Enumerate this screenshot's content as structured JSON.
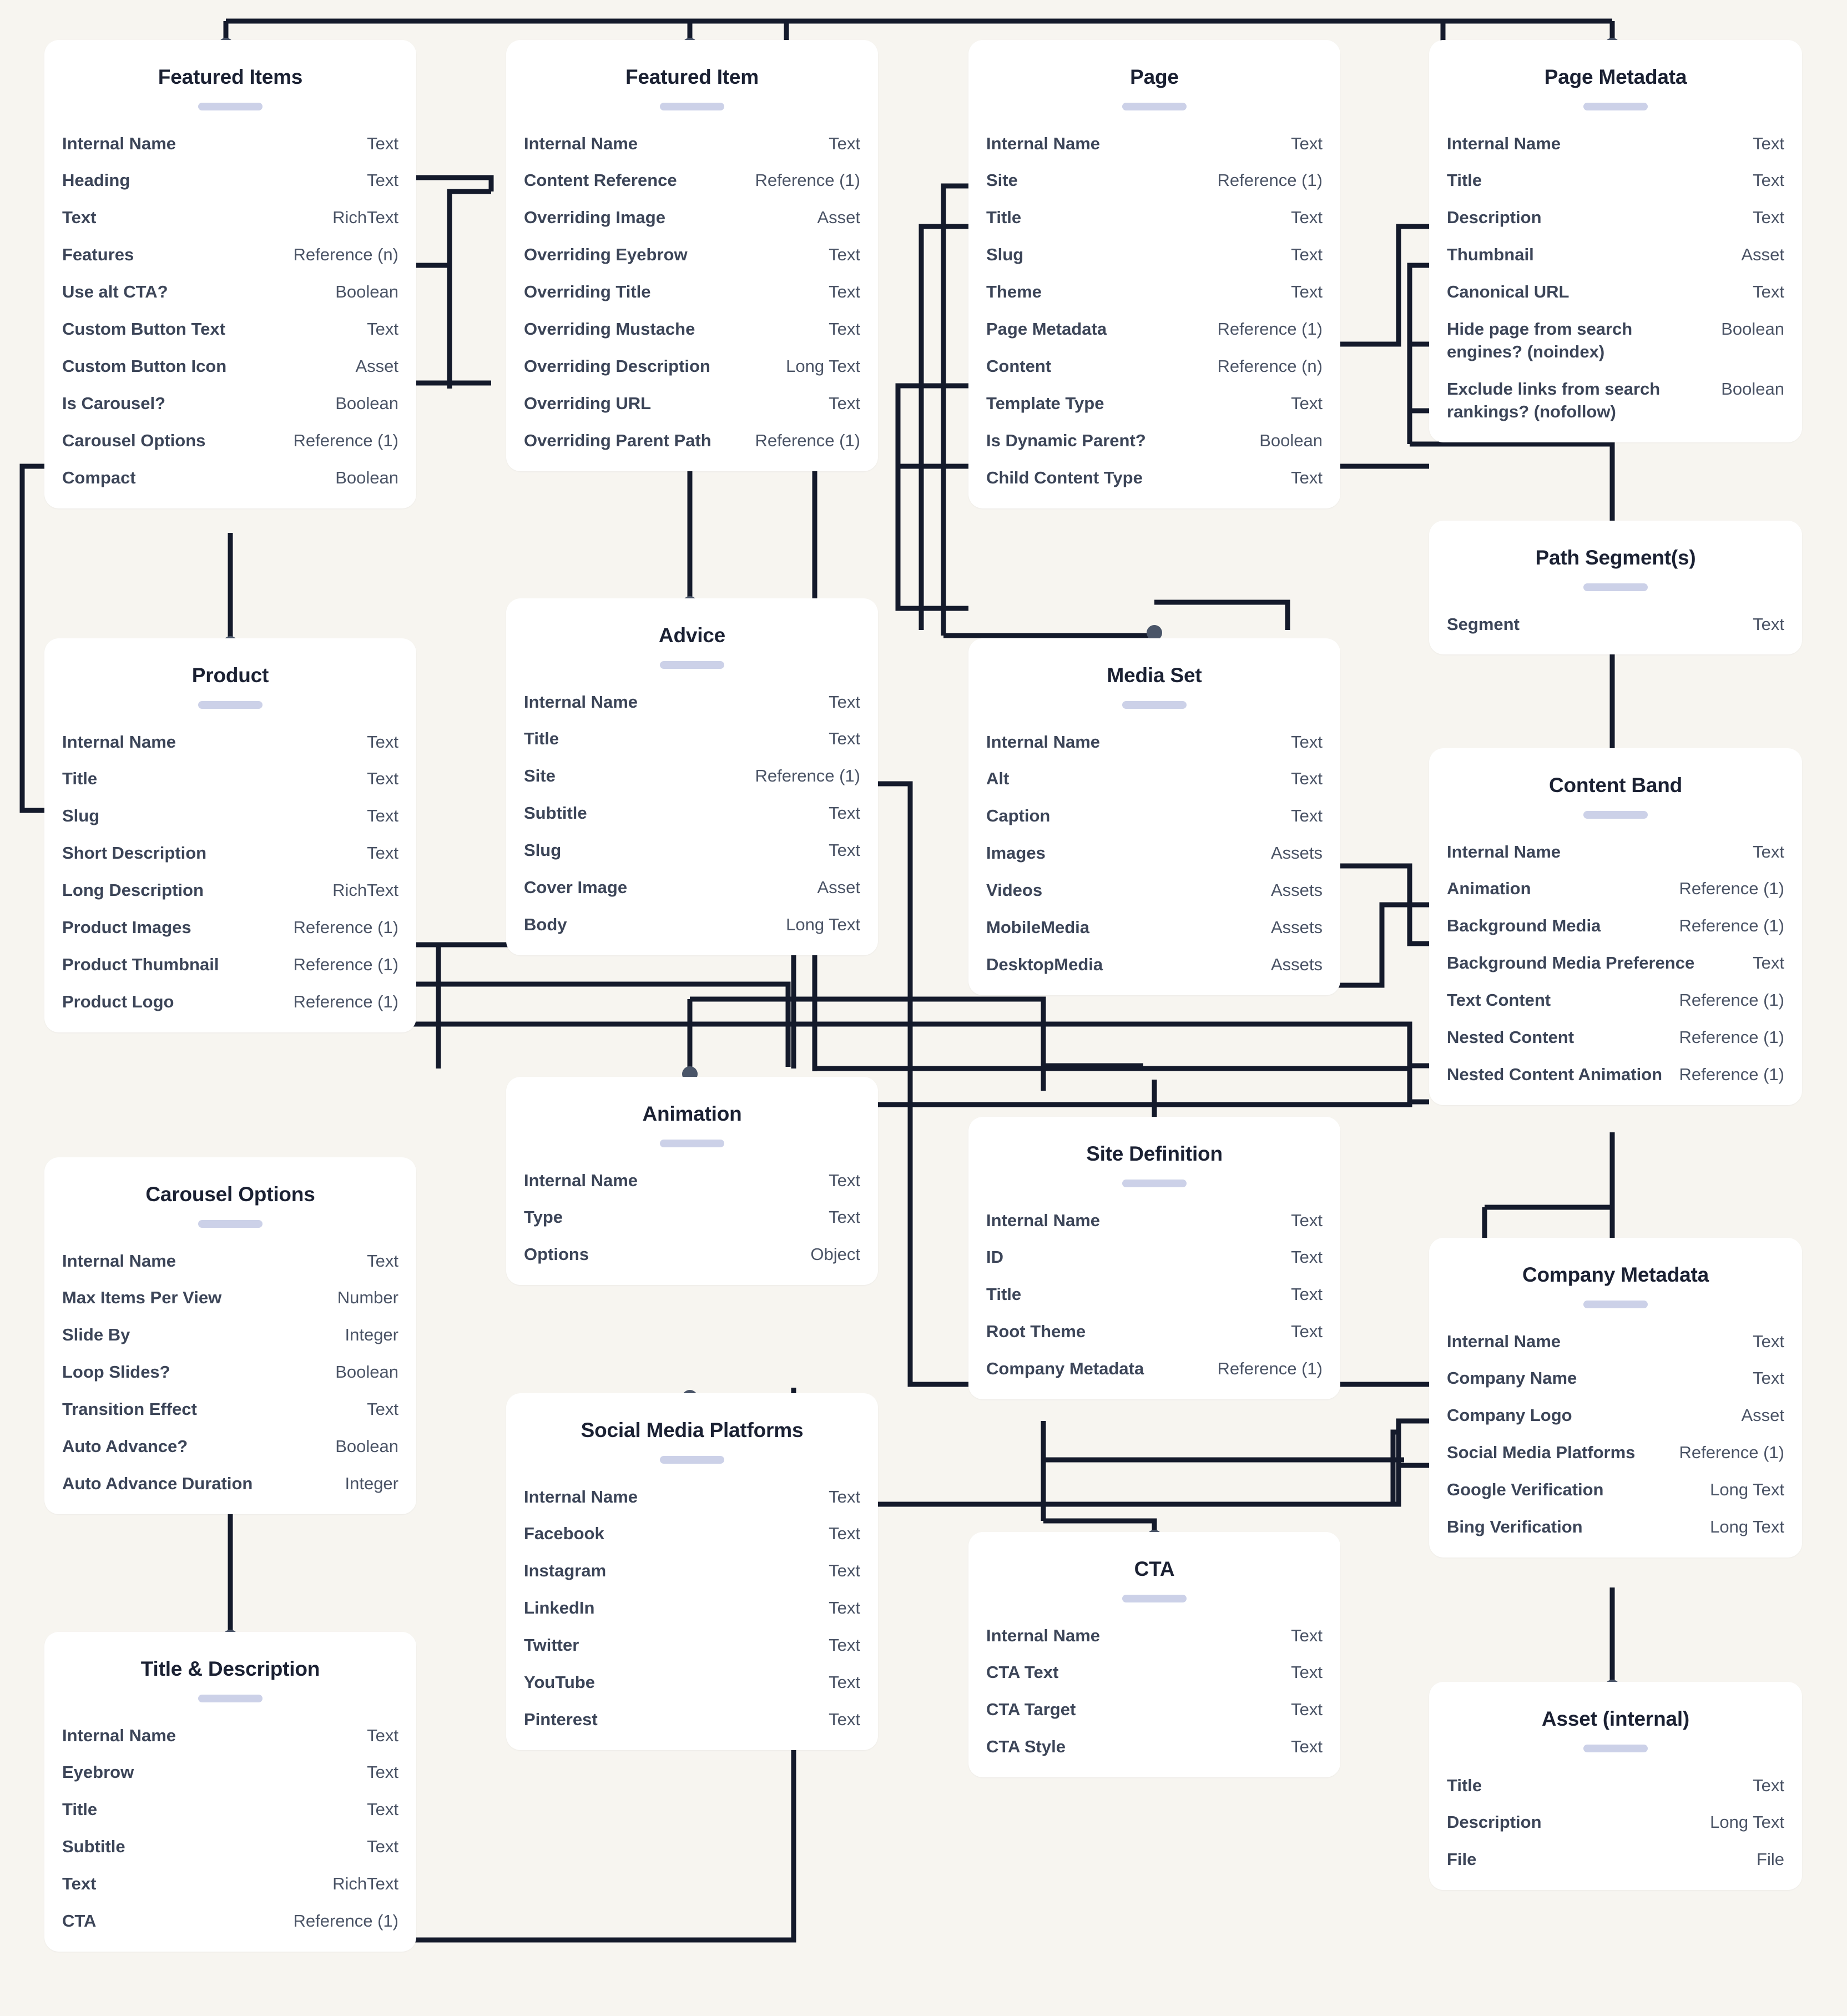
{
  "diagram": {
    "title": "Content Model Diagram",
    "background_color": "#f7f5f0",
    "card_color": "#ffffff",
    "accent_color": "#ccd1e8",
    "connector_color": "#141a2b",
    "node_dot_color": "#4a5568"
  },
  "cards": [
    {
      "id": "featured-items",
      "title": "Featured Items",
      "fields": [
        {
          "name": "Internal Name",
          "type": "Text"
        },
        {
          "name": "Heading",
          "type": "Text"
        },
        {
          "name": "Text",
          "type": "RichText"
        },
        {
          "name": "Features",
          "type": "Reference (n)"
        },
        {
          "name": "Use alt CTA?",
          "type": "Boolean"
        },
        {
          "name": "Custom Button Text",
          "type": "Text"
        },
        {
          "name": "Custom Button Icon",
          "type": "Asset"
        },
        {
          "name": "Is Carousel?",
          "type": "Boolean"
        },
        {
          "name": "Carousel Options",
          "type": "Reference (1)"
        },
        {
          "name": "Compact",
          "type": "Boolean"
        }
      ]
    },
    {
      "id": "featured-item",
      "title": "Featured Item",
      "fields": [
        {
          "name": "Internal Name",
          "type": "Text"
        },
        {
          "name": "Content Reference",
          "type": "Reference (1)"
        },
        {
          "name": "Overriding Image",
          "type": "Asset"
        },
        {
          "name": "Overriding Eyebrow",
          "type": "Text"
        },
        {
          "name": "Overriding Title",
          "type": "Text"
        },
        {
          "name": "Overriding Mustache",
          "type": "Text"
        },
        {
          "name": "Overriding Description",
          "type": "Long Text"
        },
        {
          "name": "Overriding URL",
          "type": "Text"
        },
        {
          "name": "Overriding Parent Path",
          "type": "Reference (1)"
        }
      ]
    },
    {
      "id": "page",
      "title": "Page",
      "fields": [
        {
          "name": "Internal Name",
          "type": "Text"
        },
        {
          "name": "Site",
          "type": "Reference (1)"
        },
        {
          "name": "Title",
          "type": "Text"
        },
        {
          "name": "Slug",
          "type": "Text"
        },
        {
          "name": "Theme",
          "type": "Text"
        },
        {
          "name": "Page Metadata",
          "type": "Reference (1)"
        },
        {
          "name": "Content",
          "type": "Reference (n)"
        },
        {
          "name": "Template Type",
          "type": "Text"
        },
        {
          "name": "Is Dynamic Parent?",
          "type": "Boolean"
        },
        {
          "name": "Child Content Type",
          "type": "Text"
        }
      ]
    },
    {
      "id": "page-metadata",
      "title": "Page Metadata",
      "fields": [
        {
          "name": "Internal Name",
          "type": "Text"
        },
        {
          "name": "Title",
          "type": "Text"
        },
        {
          "name": "Description",
          "type": "Text"
        },
        {
          "name": "Thumbnail",
          "type": "Asset"
        },
        {
          "name": "Canonical URL",
          "type": "Text"
        },
        {
          "name": "Hide page from search engines? (noindex)",
          "type": "Boolean"
        },
        {
          "name": "Exclude links from search rankings? (nofollow)",
          "type": "Boolean"
        }
      ]
    },
    {
      "id": "product",
      "title": "Product",
      "fields": [
        {
          "name": "Internal Name",
          "type": "Text"
        },
        {
          "name": "Title",
          "type": "Text"
        },
        {
          "name": "Slug",
          "type": "Text"
        },
        {
          "name": "Short Description",
          "type": "Text"
        },
        {
          "name": "Long Description",
          "type": "RichText"
        },
        {
          "name": "Product Images",
          "type": "Reference (1)"
        },
        {
          "name": "Product Thumbnail",
          "type": "Reference (1)"
        },
        {
          "name": "Product Logo",
          "type": "Reference (1)"
        }
      ]
    },
    {
      "id": "advice",
      "title": "Advice",
      "fields": [
        {
          "name": "Internal Name",
          "type": "Text"
        },
        {
          "name": "Title",
          "type": "Text"
        },
        {
          "name": "Site",
          "type": "Reference (1)"
        },
        {
          "name": "Subtitle",
          "type": "Text"
        },
        {
          "name": "Slug",
          "type": "Text"
        },
        {
          "name": "Cover Image",
          "type": "Asset"
        },
        {
          "name": "Body",
          "type": "Long Text"
        }
      ]
    },
    {
      "id": "media-set",
      "title": "Media Set",
      "fields": [
        {
          "name": "Internal Name",
          "type": "Text"
        },
        {
          "name": "Alt",
          "type": "Text"
        },
        {
          "name": "Caption",
          "type": "Text"
        },
        {
          "name": "Images",
          "type": "Assets"
        },
        {
          "name": "Videos",
          "type": "Assets"
        },
        {
          "name": "MobileMedia",
          "type": "Assets"
        },
        {
          "name": "DesktopMedia",
          "type": "Assets"
        }
      ]
    },
    {
      "id": "path-segments",
      "title": "Path Segment(s)",
      "fields": [
        {
          "name": "Segment",
          "type": "Text"
        }
      ]
    },
    {
      "id": "content-band",
      "title": "Content Band",
      "fields": [
        {
          "name": "Internal Name",
          "type": "Text"
        },
        {
          "name": "Animation",
          "type": "Reference (1)"
        },
        {
          "name": "Background Media",
          "type": "Reference (1)"
        },
        {
          "name": "Background Media Preference",
          "type": "Text"
        },
        {
          "name": "Text Content",
          "type": "Reference (1)"
        },
        {
          "name": "Nested Content",
          "type": "Reference (1)"
        },
        {
          "name": "Nested Content Animation",
          "type": "Reference (1)"
        }
      ]
    },
    {
      "id": "carousel-options",
      "title": "Carousel Options",
      "fields": [
        {
          "name": "Internal Name",
          "type": "Text"
        },
        {
          "name": "Max Items Per View",
          "type": "Number"
        },
        {
          "name": "Slide By",
          "type": "Integer"
        },
        {
          "name": "Loop Slides?",
          "type": "Boolean"
        },
        {
          "name": "Transition Effect",
          "type": "Text"
        },
        {
          "name": "Auto Advance?",
          "type": "Boolean"
        },
        {
          "name": "Auto Advance Duration",
          "type": "Integer"
        }
      ]
    },
    {
      "id": "animation",
      "title": "Animation",
      "fields": [
        {
          "name": "Internal Name",
          "type": "Text"
        },
        {
          "name": "Type",
          "type": "Text"
        },
        {
          "name": "Options",
          "type": "Object"
        }
      ]
    },
    {
      "id": "site-definition",
      "title": "Site Definition",
      "fields": [
        {
          "name": "Internal Name",
          "type": "Text"
        },
        {
          "name": "ID",
          "type": "Text"
        },
        {
          "name": "Title",
          "type": "Text"
        },
        {
          "name": "Root Theme",
          "type": "Text"
        },
        {
          "name": "Company Metadata",
          "type": "Reference (1)"
        }
      ]
    },
    {
      "id": "company-metadata",
      "title": "Company Metadata",
      "fields": [
        {
          "name": "Internal Name",
          "type": "Text"
        },
        {
          "name": "Company Name",
          "type": "Text"
        },
        {
          "name": "Company Logo",
          "type": "Asset"
        },
        {
          "name": "Social Media Platforms",
          "type": "Reference (1)"
        },
        {
          "name": "Google Verification",
          "type": "Long Text"
        },
        {
          "name": "Bing Verification",
          "type": "Long Text"
        }
      ]
    },
    {
      "id": "social-media-platforms",
      "title": "Social Media Platforms",
      "fields": [
        {
          "name": "Internal Name",
          "type": "Text"
        },
        {
          "name": "Facebook",
          "type": "Text"
        },
        {
          "name": "Instagram",
          "type": "Text"
        },
        {
          "name": "LinkedIn",
          "type": "Text"
        },
        {
          "name": "Twitter",
          "type": "Text"
        },
        {
          "name": "YouTube",
          "type": "Text"
        },
        {
          "name": "Pinterest",
          "type": "Text"
        }
      ]
    },
    {
      "id": "cta",
      "title": "CTA",
      "fields": [
        {
          "name": "Internal Name",
          "type": "Text"
        },
        {
          "name": "CTA Text",
          "type": "Text"
        },
        {
          "name": "CTA Target",
          "type": "Text"
        },
        {
          "name": "CTA Style",
          "type": "Text"
        }
      ]
    },
    {
      "id": "title-description",
      "title": "Title & Description",
      "fields": [
        {
          "name": "Internal Name",
          "type": "Text"
        },
        {
          "name": "Eyebrow",
          "type": "Text"
        },
        {
          "name": "Title",
          "type": "Text"
        },
        {
          "name": "Subtitle",
          "type": "Text"
        },
        {
          "name": "Text",
          "type": "RichText"
        },
        {
          "name": "CTA",
          "type": "Reference (1)"
        }
      ]
    },
    {
      "id": "asset-internal",
      "title": "Asset (internal)",
      "fields": [
        {
          "name": "Title",
          "type": "Text"
        },
        {
          "name": "Description",
          "type": "Long Text"
        },
        {
          "name": "File",
          "type": "File"
        }
      ]
    }
  ]
}
